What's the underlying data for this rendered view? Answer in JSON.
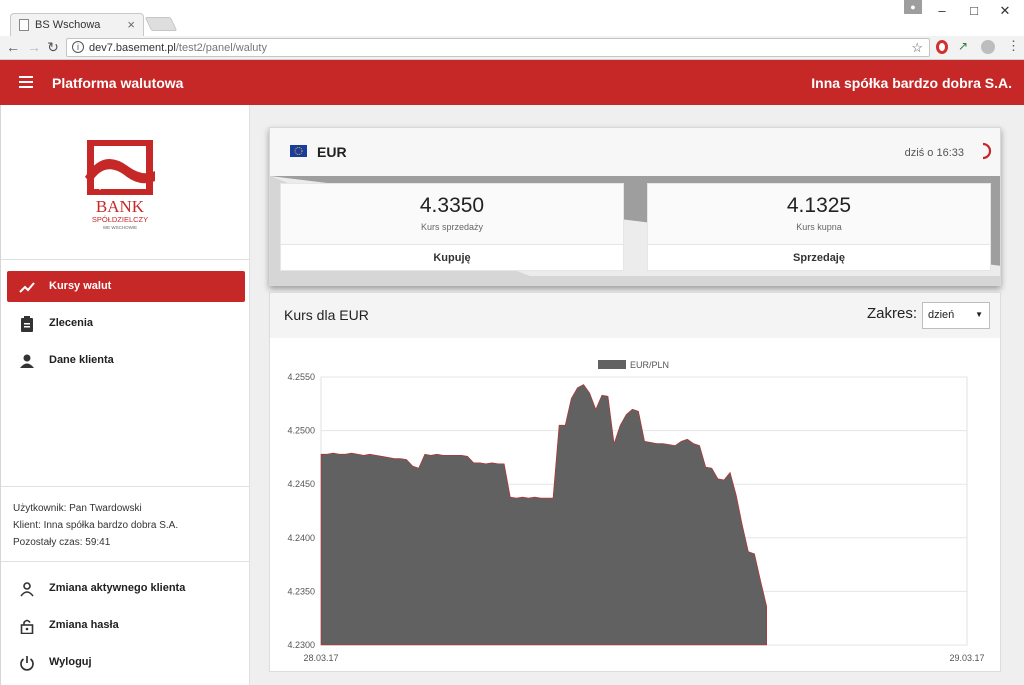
{
  "browser": {
    "tab_title": "BS Wschowa",
    "url_host": "dev7.basement.pl",
    "url_path": "/test2/panel/waluty"
  },
  "header": {
    "title": "Platforma walutowa",
    "company": "Inna spółka bardzo dobra S.A."
  },
  "logo": {
    "line1": "BANK",
    "line2": "SPÓŁDZIELCZY",
    "line3": "WE WSCHOWIE"
  },
  "sidebar": {
    "nav": [
      {
        "label": "Kursy walut",
        "icon": "trending-up-icon",
        "active": true
      },
      {
        "label": "Zlecenia",
        "icon": "clipboard-icon",
        "active": false
      },
      {
        "label": "Dane klienta",
        "icon": "person-icon",
        "active": false
      }
    ],
    "user_line": "Użytkownik: Pan Twardowski",
    "client_line": "Klient: Inna spółka bardzo dobra S.A.",
    "time_line": "Pozostały czas: 59:41",
    "bottom_nav": [
      {
        "label": "Zmiana aktywnego klienta",
        "icon": "person-outline-icon"
      },
      {
        "label": "Zmiana hasła",
        "icon": "lock-icon"
      },
      {
        "label": "Wyloguj",
        "icon": "power-icon"
      }
    ]
  },
  "rate": {
    "currency": "EUR",
    "time": "dziś o 16:33",
    "sell": {
      "value": "4.3350",
      "label": "Kurs sprzedaży",
      "button": "Kupuję"
    },
    "buy": {
      "value": "4.1325",
      "label": "Kurs kupna",
      "button": "Sprzedaję"
    }
  },
  "chart": {
    "title": "Kurs dla EUR",
    "range_label": "Zakres:",
    "range_value": "dzień"
  },
  "chart_data": {
    "type": "area",
    "series": [
      {
        "name": "EUR/PLN",
        "color": "#616161",
        "values": [
          4.2478,
          4.2478,
          4.2479,
          4.2478,
          4.2478,
          4.2479,
          4.2478,
          4.2477,
          4.2478,
          4.2477,
          4.2476,
          4.2475,
          4.2474,
          4.2474,
          4.2473,
          4.2467,
          4.2465,
          4.2478,
          4.2477,
          4.2478,
          4.2477,
          4.2477,
          4.2477,
          4.2477,
          4.2476,
          4.247,
          4.247,
          4.2469,
          4.247,
          4.2469,
          4.2469,
          4.2438,
          4.2437,
          4.2438,
          4.2437,
          4.2438,
          4.2437,
          4.2437,
          4.2437,
          4.2505,
          4.2505,
          4.253,
          4.254,
          4.2543,
          4.2535,
          4.252,
          4.2533,
          4.2532,
          4.2488,
          4.2505,
          4.2515,
          4.252,
          4.2518,
          4.249,
          4.2489,
          4.2488,
          4.2488,
          4.2487,
          4.2486,
          4.249,
          4.2492,
          4.2488,
          4.2486,
          4.2466,
          4.2465,
          4.2455,
          4.2454,
          4.2461,
          4.244,
          4.2412,
          4.2387,
          4.2385,
          4.236,
          4.2336
        ]
      }
    ],
    "x_start": "28.03.17",
    "x_end": "29.03.17",
    "ylim": [
      4.23,
      4.255
    ],
    "y_ticks": [
      "4.2300",
      "4.2350",
      "4.2400",
      "4.2450",
      "4.2500",
      "4.2550"
    ],
    "x_fill_fraction": 0.69,
    "legend": "top",
    "grid": true
  }
}
